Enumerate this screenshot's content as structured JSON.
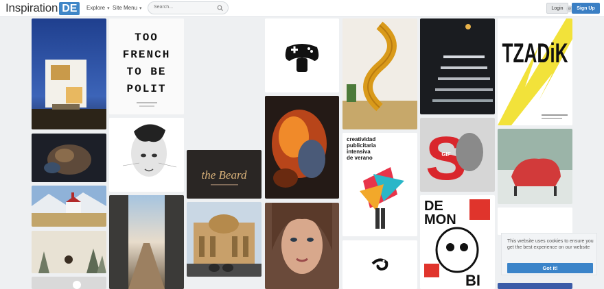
{
  "header": {
    "logo_text": "Inspiration",
    "logo_badge": "DE",
    "nav": [
      {
        "label": "Explore",
        "icon": "chevron-down-icon"
      },
      {
        "label": "Site Menu",
        "icon": "chevron-down-icon"
      }
    ],
    "search_placeholder": "Search...",
    "login_label": "Login",
    "or_label": "or",
    "signup_label": "Sign Up"
  },
  "tiles": {
    "poster_text": [
      "TOO",
      "FRENCH",
      "TO BE",
      "POLIT"
    ],
    "beard_text": "the Beard",
    "creatividad_text": [
      "creatividad",
      "publicitaria",
      "intensiva",
      "de verano"
    ],
    "tzadik_text": "TZADiK",
    "demon_text": [
      "DE",
      "MON",
      "BI"
    ],
    "gif_text": "GIF"
  },
  "cookie": {
    "message": "This website uses cookies to ensure you get the best experience on our website",
    "button_label": "Got it!"
  },
  "colors": {
    "brand_blue": "#3f86c7",
    "signup_blue": "#3a7fc4",
    "background": "#eef0f2"
  }
}
